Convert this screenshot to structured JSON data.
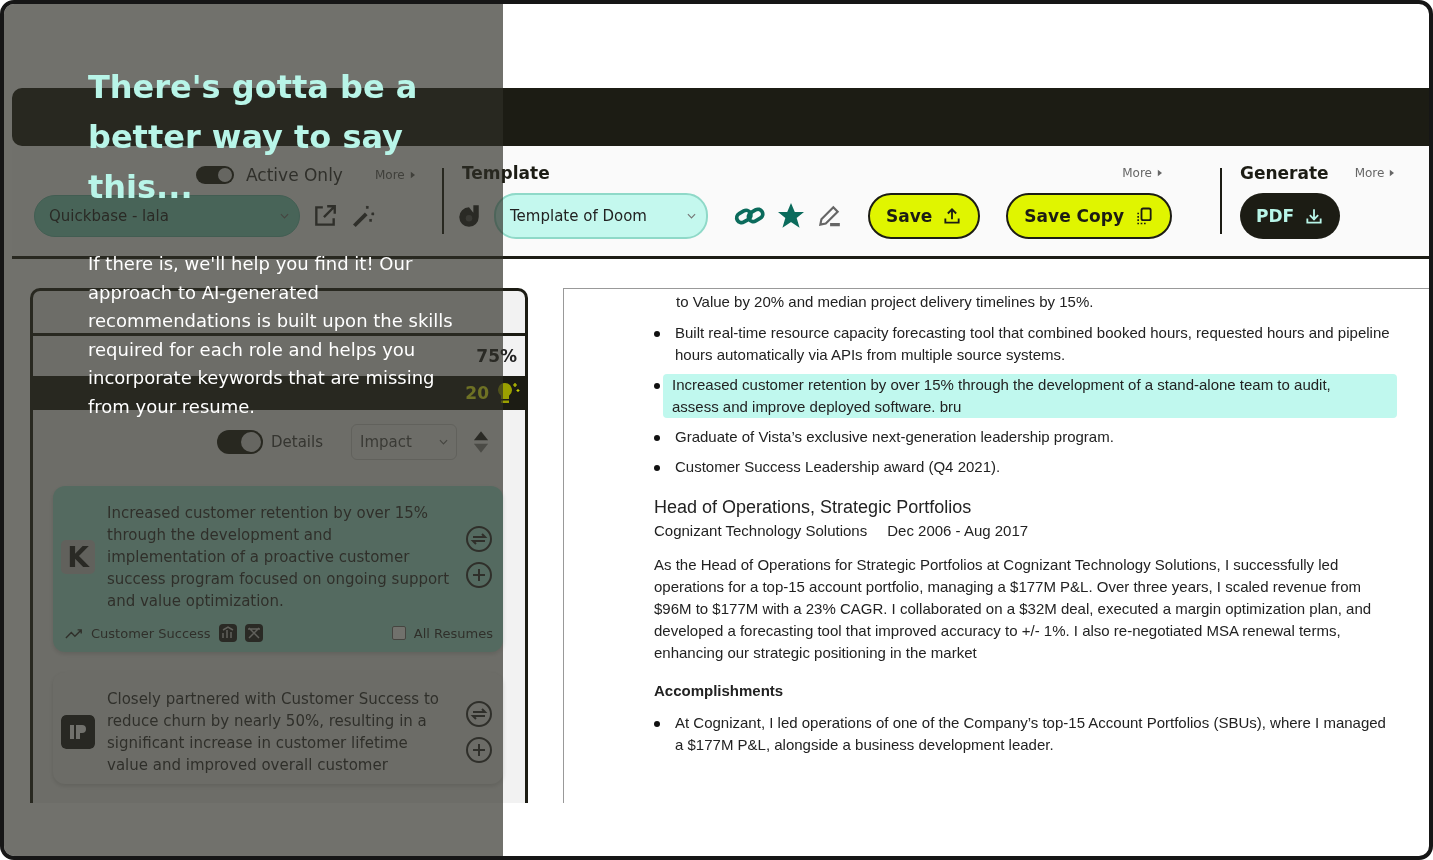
{
  "overlay": {
    "headline_lines": [
      "There's gotta be a",
      "better way to say",
      "this..."
    ],
    "body": "If there is, we'll help you find it! Our approach to AI-generated recommendations is built upon the skills required for each role and helps you incorporate keywords that are missing from your resume."
  },
  "application": {
    "toggle_label": "Active Only",
    "toggle_on": true,
    "more": "More",
    "select_value": "Quickbase - lala"
  },
  "template": {
    "title": "Template",
    "more": "More",
    "select_value": "Template of Doom",
    "favorite": true,
    "buttons": [
      {
        "label": "Save",
        "kind": "upload"
      },
      {
        "label": "Save Copy",
        "kind": "copy"
      }
    ]
  },
  "generate": {
    "title": "Generate",
    "more": "More",
    "button": "PDF"
  },
  "panel": {
    "overall": "75%",
    "updates_count": "20",
    "details_label": "Details",
    "details_on": true,
    "sort": "Impact",
    "cards": [
      {
        "logo": "K",
        "kind": "letter",
        "selected": true,
        "text": "Increased customer retention by over 15% through the development and implementation of a proactive customer success program focused on ongoing support and value optimization.",
        "category": "Customer Success",
        "all_resumes_label": "All Resumes",
        "all_resumes": false
      },
      {
        "kind": "mark",
        "selected": false,
        "text": "Closely partnered with Customer Success to reduce churn by nearly 50%, resulting in a significant increase in customer lifetime value and improved overall customer"
      }
    ]
  },
  "resume": {
    "blocks": [
      {
        "kind": "continuation",
        "text": "to Value by 20% and median project delivery timelines by 15%."
      },
      {
        "kind": "bullet",
        "text": "Built real-time resource capacity forecasting tool that combined booked hours, requested hours and pipeline hours automatically via APIs from multiple source systems.",
        "selected": false
      },
      {
        "kind": "bullet",
        "text": "Increased customer retention by over 15% through the development of a stand-alone team to audit, assess and improve deployed software. bru",
        "selected": true
      },
      {
        "kind": "bullet",
        "text": "Graduate of Vista’s exclusive next-generation leadership program.",
        "selected": false
      },
      {
        "kind": "bullet",
        "text": "Customer Success Leadership award (Q4 2021).",
        "selected": false
      },
      {
        "kind": "job",
        "title": "Head of Operations, Strategic Portfolios",
        "company": "Cognizant Technology Solutions",
        "dates": "Dec 2006 - Aug 2017"
      },
      {
        "kind": "paragraph",
        "text": "As the Head of Operations for Strategic Portfolios at Cognizant Technology Solutions, I successfully led operations for a top-15 account portfolio, managing a $177M P&L. Over three years, I scaled revenue from $96M to $177M with a 23% CAGR. I collaborated on a $32M deal, executed a margin optimization plan, and developed a forecasting tool that improved accuracy to +/- 1%. I also re-negotiated MSA renewal terms, enhancing our strategic positioning in the market"
      },
      {
        "kind": "subheading",
        "text": "Accomplishments"
      },
      {
        "kind": "bullet",
        "text": "At Cognizant, I led operations of one of the Company’s top-15 Account Portfolios (SBUs), where I managed a $177M P&L, alongside a business development leader.",
        "selected": false
      }
    ]
  }
}
